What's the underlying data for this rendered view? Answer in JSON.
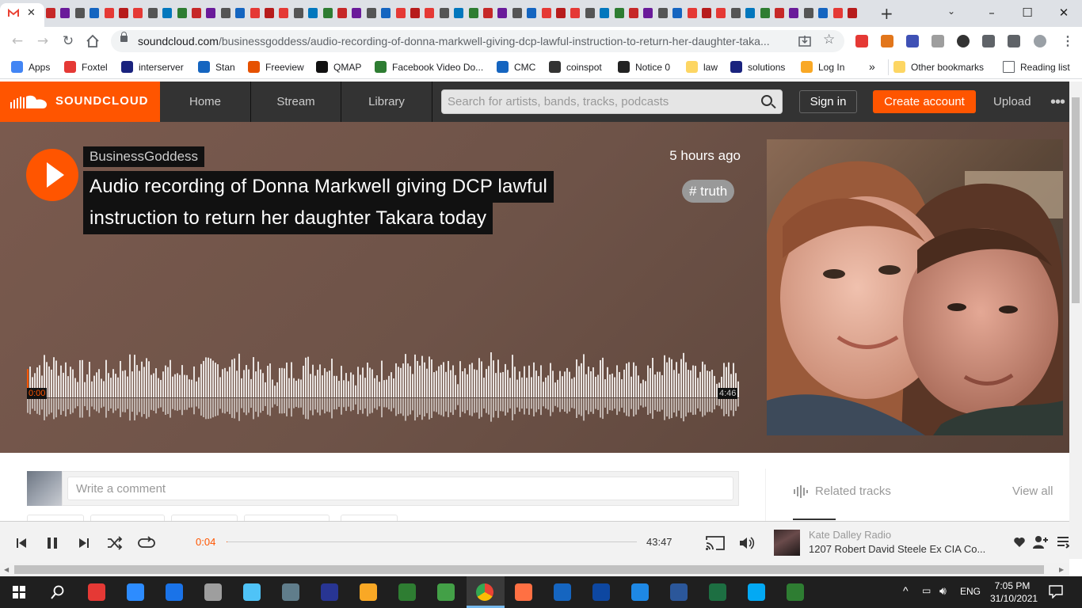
{
  "browser": {
    "url_domain": "soundcloud.com",
    "url_path": "/businessgoddess/audio-recording-of-donna-markwell-giving-dcp-lawful-instruction-to-return-her-daughter-taka...",
    "window_controls": [
      "–",
      "☐",
      "✕"
    ],
    "new_tab": "+",
    "bookmarks": [
      {
        "label": "Apps",
        "color": "#4285f4"
      },
      {
        "label": "Foxtel",
        "color": "#e53935"
      },
      {
        "label": "interserver",
        "color": "#1a237e"
      },
      {
        "label": "Stan",
        "color": "#1565c0"
      },
      {
        "label": "Freeview",
        "color": "#e65100"
      },
      {
        "label": "QMAP",
        "color": "#111111"
      },
      {
        "label": "Facebook Video Do...",
        "color": "#2e7d32"
      },
      {
        "label": "CMC",
        "color": "#1565c0"
      },
      {
        "label": "coinspot",
        "color": "#333333"
      },
      {
        "label": "Notice 0",
        "color": "#222222"
      },
      {
        "label": "law",
        "color": "#fdd663"
      },
      {
        "label": "solutions",
        "color": "#1a237e"
      },
      {
        "label": "Log In",
        "color": "#f9a825"
      }
    ],
    "bookmarks_overflow": "»",
    "other_bookmarks": "Other bookmarks",
    "reading_list": "Reading list"
  },
  "header": {
    "logo_text": "SOUNDCLOUD",
    "nav": [
      "Home",
      "Stream",
      "Library"
    ],
    "search_placeholder": "Search for artists, bands, tracks, podcasts",
    "sign_in": "Sign in",
    "create_account": "Create account",
    "upload": "Upload",
    "more": "•••"
  },
  "track": {
    "artist": "BusinessGoddess",
    "title_line1": "Audio recording of Donna Markwell giving DCP lawful",
    "title_line2": "instruction to return her daughter Takara today",
    "posted": "5 hours ago",
    "tag": "# truth",
    "time_start": "0:00",
    "time_end": "4:46"
  },
  "comments": {
    "placeholder": "Write a comment"
  },
  "sidebar": {
    "related_label": "Related tracks",
    "view_all": "View all"
  },
  "player": {
    "elapsed": "0:04",
    "total": "43:47",
    "progress_fraction": 0.0015,
    "artist": "Kate Dalley Radio",
    "track": "1207 Robert David Steele Ex CIA Co..."
  },
  "taskbar": {
    "language": "ENG",
    "time": "7:05 PM",
    "date": "31/10/2021"
  },
  "colors": {
    "accent": "#ff5500",
    "header_bg": "#333333"
  }
}
